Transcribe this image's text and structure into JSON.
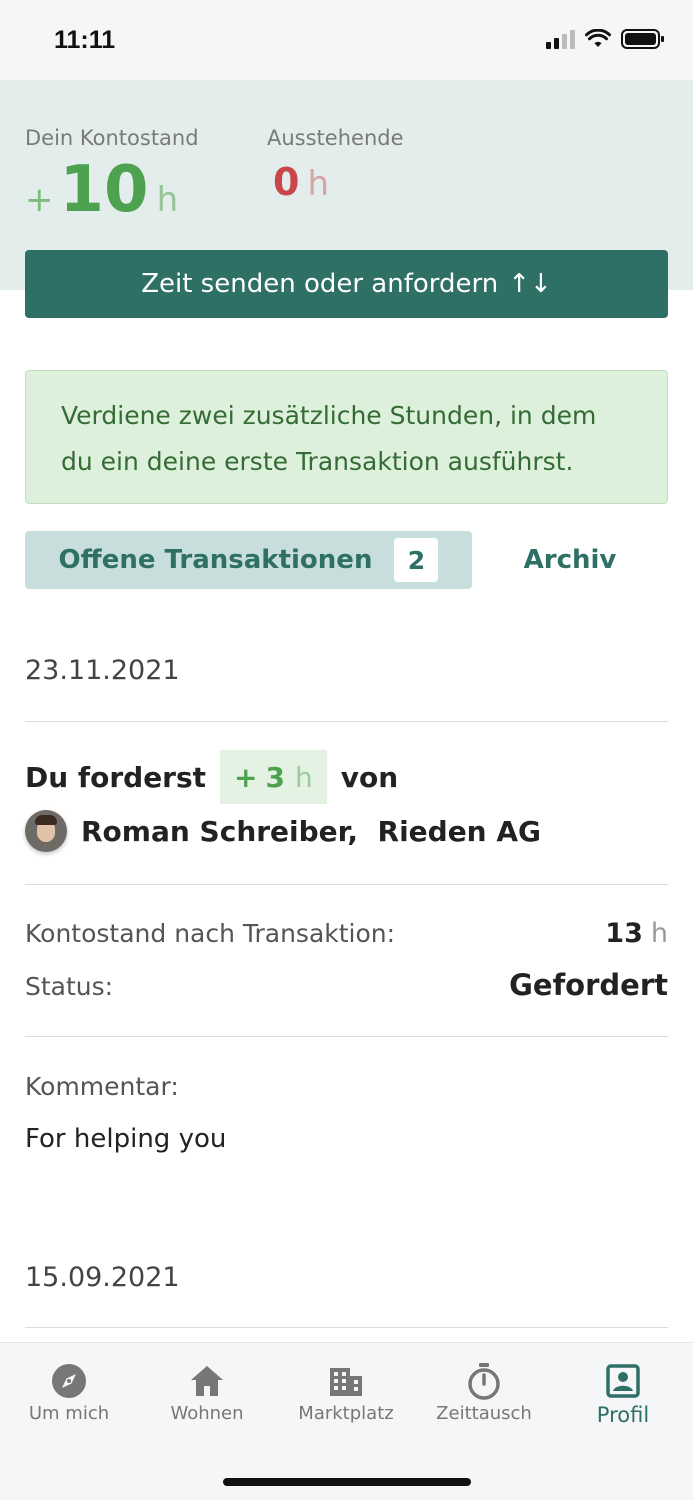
{
  "status_bar": {
    "time": "11:11"
  },
  "balance": {
    "label": "Dein Kontostand",
    "sign": "+",
    "value": "10",
    "unit": "h",
    "pending_label": "Ausstehende",
    "pending_value": "0",
    "pending_unit": "h"
  },
  "send_button": {
    "label": "Zeit senden oder anfordern",
    "icon": "↑↓"
  },
  "info_banner": {
    "text": "Verdiene zwei zusätzliche Stunden, in dem du ein deine erste Transaktion ausführst."
  },
  "tabs": {
    "open_label": "Offene Transaktionen",
    "open_count": "2",
    "archive_label": "Archiv"
  },
  "transactions": [
    {
      "date": "23.11.2021",
      "request_prefix": "Du forderst",
      "amount_sign": "+",
      "amount": "3",
      "amount_unit": "h",
      "request_suffix": "von",
      "counterparty": "Roman Schreiber,  Rieden AG",
      "balance_after_label": "Kontostand nach Transaktion:",
      "balance_after_value": "13",
      "balance_after_unit": "h",
      "status_label": "Status:",
      "status_value": "Gefordert",
      "comment_label": "Kommentar:",
      "comment": "For helping you"
    },
    {
      "date": "15.09.2021"
    }
  ],
  "bottom_nav": [
    {
      "label": "Um mich",
      "icon": "compass-icon"
    },
    {
      "label": "Wohnen",
      "icon": "home-icon"
    },
    {
      "label": "Marktplatz",
      "icon": "building-icon"
    },
    {
      "label": "Zeittausch",
      "icon": "stopwatch-icon"
    },
    {
      "label": "Profil",
      "icon": "profile-icon",
      "active": true
    }
  ],
  "colors": {
    "primary": "#2e6f66",
    "positive": "#4ea24f",
    "negative": "#c9464a",
    "header_bg": "#e3eeec",
    "banner_bg": "#ddf0dc"
  }
}
